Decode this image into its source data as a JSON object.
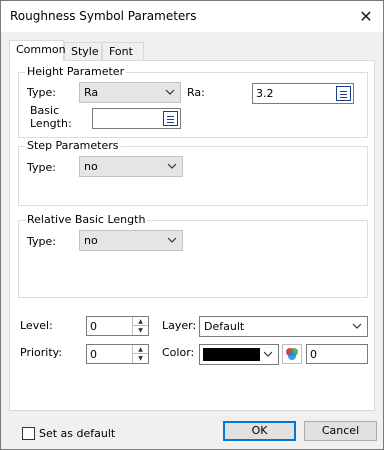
{
  "window": {
    "title": "Roughness Symbol Parameters",
    "close_glyph": "✕"
  },
  "tabs": [
    {
      "label": "Common",
      "active": true
    },
    {
      "label": "Style",
      "active": false
    },
    {
      "label": "Font",
      "active": false
    }
  ],
  "height_parameter": {
    "title": "Height Parameter",
    "type_label": "Type:",
    "type_value": "Ra",
    "ra_label": "Ra:",
    "ra_value": "3.2",
    "basic_length_label_1": "Basic",
    "basic_length_label_2": "Length:",
    "basic_length_value": ""
  },
  "step_parameters": {
    "title": "Step Parameters",
    "type_label": "Type:",
    "type_value": "no"
  },
  "relative_basic_length": {
    "title": "Relative Basic Length",
    "type_label": "Type:",
    "type_value": "no"
  },
  "properties": {
    "level_label": "Level:",
    "level_value": "0",
    "priority_label": "Priority:",
    "priority_value": "0",
    "layer_label": "Layer:",
    "layer_value": "Default",
    "color_label": "Color:",
    "color_value": "#000000",
    "color_index": "0"
  },
  "footer": {
    "set_default_label": "Set as default",
    "set_default_checked": false,
    "ok_label": "OK",
    "cancel_label": "Cancel"
  },
  "icons": {
    "dropdown": "chevron-down-icon",
    "list": "list-icon",
    "palette": "color-palette-icon",
    "spin": "spin-arrows-icon"
  }
}
